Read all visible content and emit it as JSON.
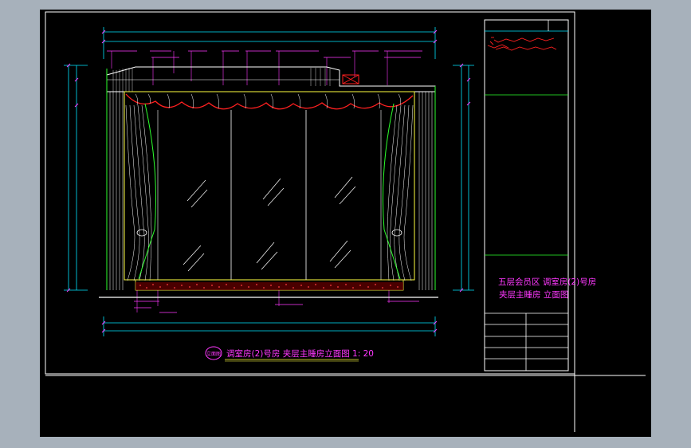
{
  "drawing": {
    "title_block": {
      "project_line1": "五层会员区 调室房(2)号房",
      "project_line2": "夹层主睡房 立面图"
    },
    "caption": {
      "badge": "立面图",
      "text": "调室房(2)号房 夹层主睡房立面图 1: 20"
    }
  },
  "colors": {
    "background": "#000000",
    "window_bg": "#a7b1bb",
    "line_white": "#ffffff",
    "line_cyan": "#00e5ff",
    "line_green": "#2cff2c",
    "line_magenta": "#ff38ff",
    "line_red": "#ff2020",
    "line_yellow": "#ffff40"
  },
  "icons": {
    "caption_badge": "circle-badge-icon",
    "break_arrow": "arrow-icon"
  }
}
